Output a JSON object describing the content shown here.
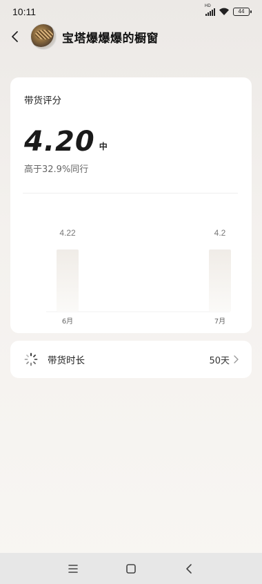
{
  "status": {
    "time": "10:11",
    "network_label": "HD",
    "battery": "44"
  },
  "header": {
    "title": "宝塔爆爆爆的橱窗"
  },
  "score_card": {
    "title": "带货评分",
    "score": "4.20",
    "level": "中",
    "compare_text": "高于32.9%同行"
  },
  "chart_data": {
    "type": "bar",
    "categories": [
      "6月",
      "7月"
    ],
    "values": [
      4.22,
      4.2
    ],
    "data_labels": [
      "4.22",
      "4.2"
    ],
    "title": "",
    "xlabel": "",
    "ylabel": "",
    "colors": {
      "bar_top": "#f2efeb",
      "bar_bottom": "#faf8f6"
    }
  },
  "duration": {
    "label": "带货时长",
    "value": "50天"
  },
  "icons": {
    "back": "chevron-left-icon",
    "loading": "loading-spinner-icon",
    "more": "chevron-right-icon",
    "nav_menu": "menu-icon",
    "nav_home": "home-square-icon",
    "nav_back": "back-triangle-icon"
  }
}
